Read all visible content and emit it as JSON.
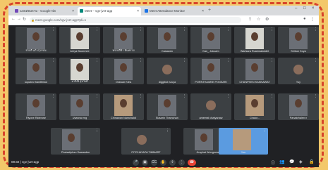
{
  "browser": {
    "tabs": [
      {
        "title": "แบบสอบถาม - Google ฟอ",
        "fav_color": "#7248b9",
        "active": false
      },
      {
        "title": "Meet – vgv-jvzt-agp",
        "fav_color": "#00897b",
        "active": true
      },
      {
        "title": "Meet Attendance Monitor",
        "fav_color": "#1a73e8",
        "active": false
      }
    ],
    "url": "meet.google.com/vgv-jvzt-agp?pli=1"
  },
  "participants": [
    {
      "name": "ชาตรี แก้วสุวรรณ",
      "kind": "cam"
    },
    {
      "name": "Areya Boonmee",
      "kind": "cam-light"
    },
    {
      "name": "ทรายสีฟ้า หินทราย",
      "kind": "cam"
    },
    {
      "name": "Kasawan",
      "kind": "cam"
    },
    {
      "name": "Kan_ Jukuam",
      "kind": "cam"
    },
    {
      "name": "Warisara Ruamsakuldet",
      "kind": "cam-light"
    },
    {
      "name": "Siribun Koya",
      "kind": "cam"
    },
    {
      "name": "supatra thanitthikul",
      "kind": "cam"
    },
    {
      "name": "มาลิณี สุขใจดี",
      "kind": "cam-light"
    },
    {
      "name": "Orawan Kitra",
      "kind": "cam"
    },
    {
      "name": "digglbst ezuya",
      "kind": "avatar"
    },
    {
      "name": "PORNTHAWEE PONSARI",
      "kind": "cam"
    },
    {
      "name": "CHANPHEN KANNAWAT",
      "kind": "cam"
    },
    {
      "name": "Tuy",
      "kind": "avatar"
    },
    {
      "name": "Riyone Riderose",
      "kind": "cam"
    },
    {
      "name": "Usanna eng",
      "kind": "cam"
    },
    {
      "name": "Chinawan Namchaidi",
      "kind": "cam-warm"
    },
    {
      "name": "Busarin Thamchan",
      "kind": "cam"
    },
    {
      "name": "ameerat chaiyanaw",
      "kind": "avatar"
    },
    {
      "name": "Chalor...",
      "kind": "cam-warm"
    },
    {
      "name": "Panakrhalen n",
      "kind": "cam"
    },
    {
      "name": "Phaisaliphan Sawasdee",
      "kind": "cam"
    },
    {
      "name": "PITCHAYAPA TIMMART",
      "kind": "avatar"
    },
    {
      "name": "Jiraphat Wongsvasi",
      "kind": "cam"
    },
    {
      "name": "You",
      "kind": "self"
    }
  ],
  "footer": {
    "time": "09:32",
    "meeting_code": "vgv-jvzt-agp"
  }
}
